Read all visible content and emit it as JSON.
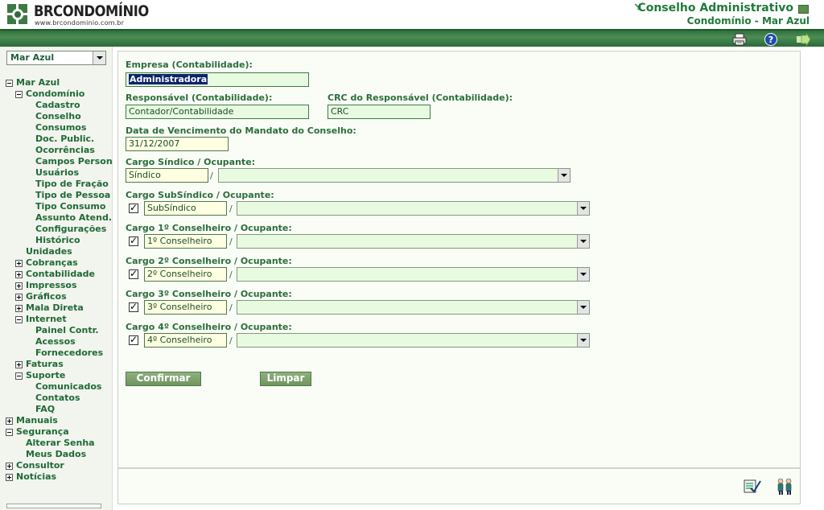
{
  "header": {
    "logo_text": "BRCONDOMÍNIO",
    "logo_url": "www.brcondominio.com.br",
    "title": "Conselho Administrativo",
    "subtitle": "Condomínio - Mar Azul"
  },
  "toolbar": {
    "icons": [
      "printer-icon",
      "help-icon",
      "exit-icon"
    ]
  },
  "sidebar": {
    "selector_value": "Mar Azul",
    "tree": [
      {
        "label": "Mar Azul",
        "level": 0,
        "toggle": "minus"
      },
      {
        "label": "Condomínio",
        "level": 1,
        "toggle": "minus"
      },
      {
        "label": "Cadastro",
        "level": 2
      },
      {
        "label": "Conselho",
        "level": 2
      },
      {
        "label": "Consumos",
        "level": 2
      },
      {
        "label": "Doc. Public.",
        "level": 2
      },
      {
        "label": "Ocorrências",
        "level": 2
      },
      {
        "label": "Campos Person",
        "level": 2
      },
      {
        "label": "Usuários",
        "level": 2
      },
      {
        "label": "Tipo de Fração",
        "level": 2
      },
      {
        "label": "Tipo de Pessoa",
        "level": 2
      },
      {
        "label": "Tipo Consumo",
        "level": 2
      },
      {
        "label": "Assunto Atend.",
        "level": 2
      },
      {
        "label": "Configurações",
        "level": 2
      },
      {
        "label": "Histórico",
        "level": 2
      },
      {
        "label": "Unidades",
        "level": 1
      },
      {
        "label": "Cobranças",
        "level": 1,
        "toggle": "plus"
      },
      {
        "label": "Contabilidade",
        "level": 1,
        "toggle": "plus"
      },
      {
        "label": "Impressos",
        "level": 1,
        "toggle": "plus"
      },
      {
        "label": "Gráficos",
        "level": 1,
        "toggle": "plus"
      },
      {
        "label": "Mala Direta",
        "level": 1,
        "toggle": "plus"
      },
      {
        "label": "Internet",
        "level": 1,
        "toggle": "minus"
      },
      {
        "label": "Painel Contr.",
        "level": 2
      },
      {
        "label": "Acessos",
        "level": 2
      },
      {
        "label": "Fornecedores",
        "level": 2
      },
      {
        "label": "Faturas",
        "level": 1,
        "toggle": "plus"
      },
      {
        "label": "Suporte",
        "level": 1,
        "toggle": "minus"
      },
      {
        "label": "Comunicados",
        "level": 2
      },
      {
        "label": "Contatos",
        "level": 2
      },
      {
        "label": "FAQ",
        "level": 2
      },
      {
        "label": "Manuais",
        "level": 0,
        "toggle": "plus"
      },
      {
        "label": "Segurança",
        "level": 0,
        "toggle": "minus"
      },
      {
        "label": "Alterar Senha",
        "level": 1
      },
      {
        "label": "Meus Dados",
        "level": 1
      },
      {
        "label": "Consultor",
        "level": 0,
        "toggle": "plus"
      },
      {
        "label": "Notícias",
        "level": 0,
        "toggle": "plus"
      }
    ]
  },
  "form": {
    "empresa_label": "Empresa (Contabilidade):",
    "empresa_value": "Administradora",
    "responsavel_label": "Responsável (Contabilidade):",
    "responsavel_value": "Contador/Contabilidade",
    "crc_label": "CRC do Responsável (Contabilidade):",
    "crc_value": "CRC",
    "vencimento_label": "Data de Vencimento do Mandato do Conselho:",
    "vencimento_value": "31/12/2007",
    "slash": "/",
    "cargos": [
      {
        "label": "Cargo Síndico / Ocupante:",
        "value": "Síndico",
        "checked": null
      },
      {
        "label": "Cargo SubSíndico / Ocupante:",
        "value": "SubSíndico",
        "checked": true
      },
      {
        "label": "Cargo 1º Conselheiro / Ocupante:",
        "value": "1º Conselheiro",
        "checked": true
      },
      {
        "label": "Cargo 2º Conselheiro / Ocupante:",
        "value": "2º Conselheiro",
        "checked": true
      },
      {
        "label": "Cargo 3º Conselheiro / Ocupante:",
        "value": "3º Conselheiro",
        "checked": true
      },
      {
        "label": "Cargo 4º Conselheiro / Ocupante:",
        "value": "4º Conselheiro",
        "checked": true
      }
    ],
    "confirm_label": "Confirmar",
    "clear_label": "Limpar"
  },
  "footer": {
    "icons": [
      "edit-list-icon",
      "users-icon"
    ]
  },
  "colors": {
    "brand_green": "#2f6e3c",
    "text_green": "#1f6a36",
    "field_bg": "#e8fbe0",
    "highlight": "#0a246a"
  }
}
